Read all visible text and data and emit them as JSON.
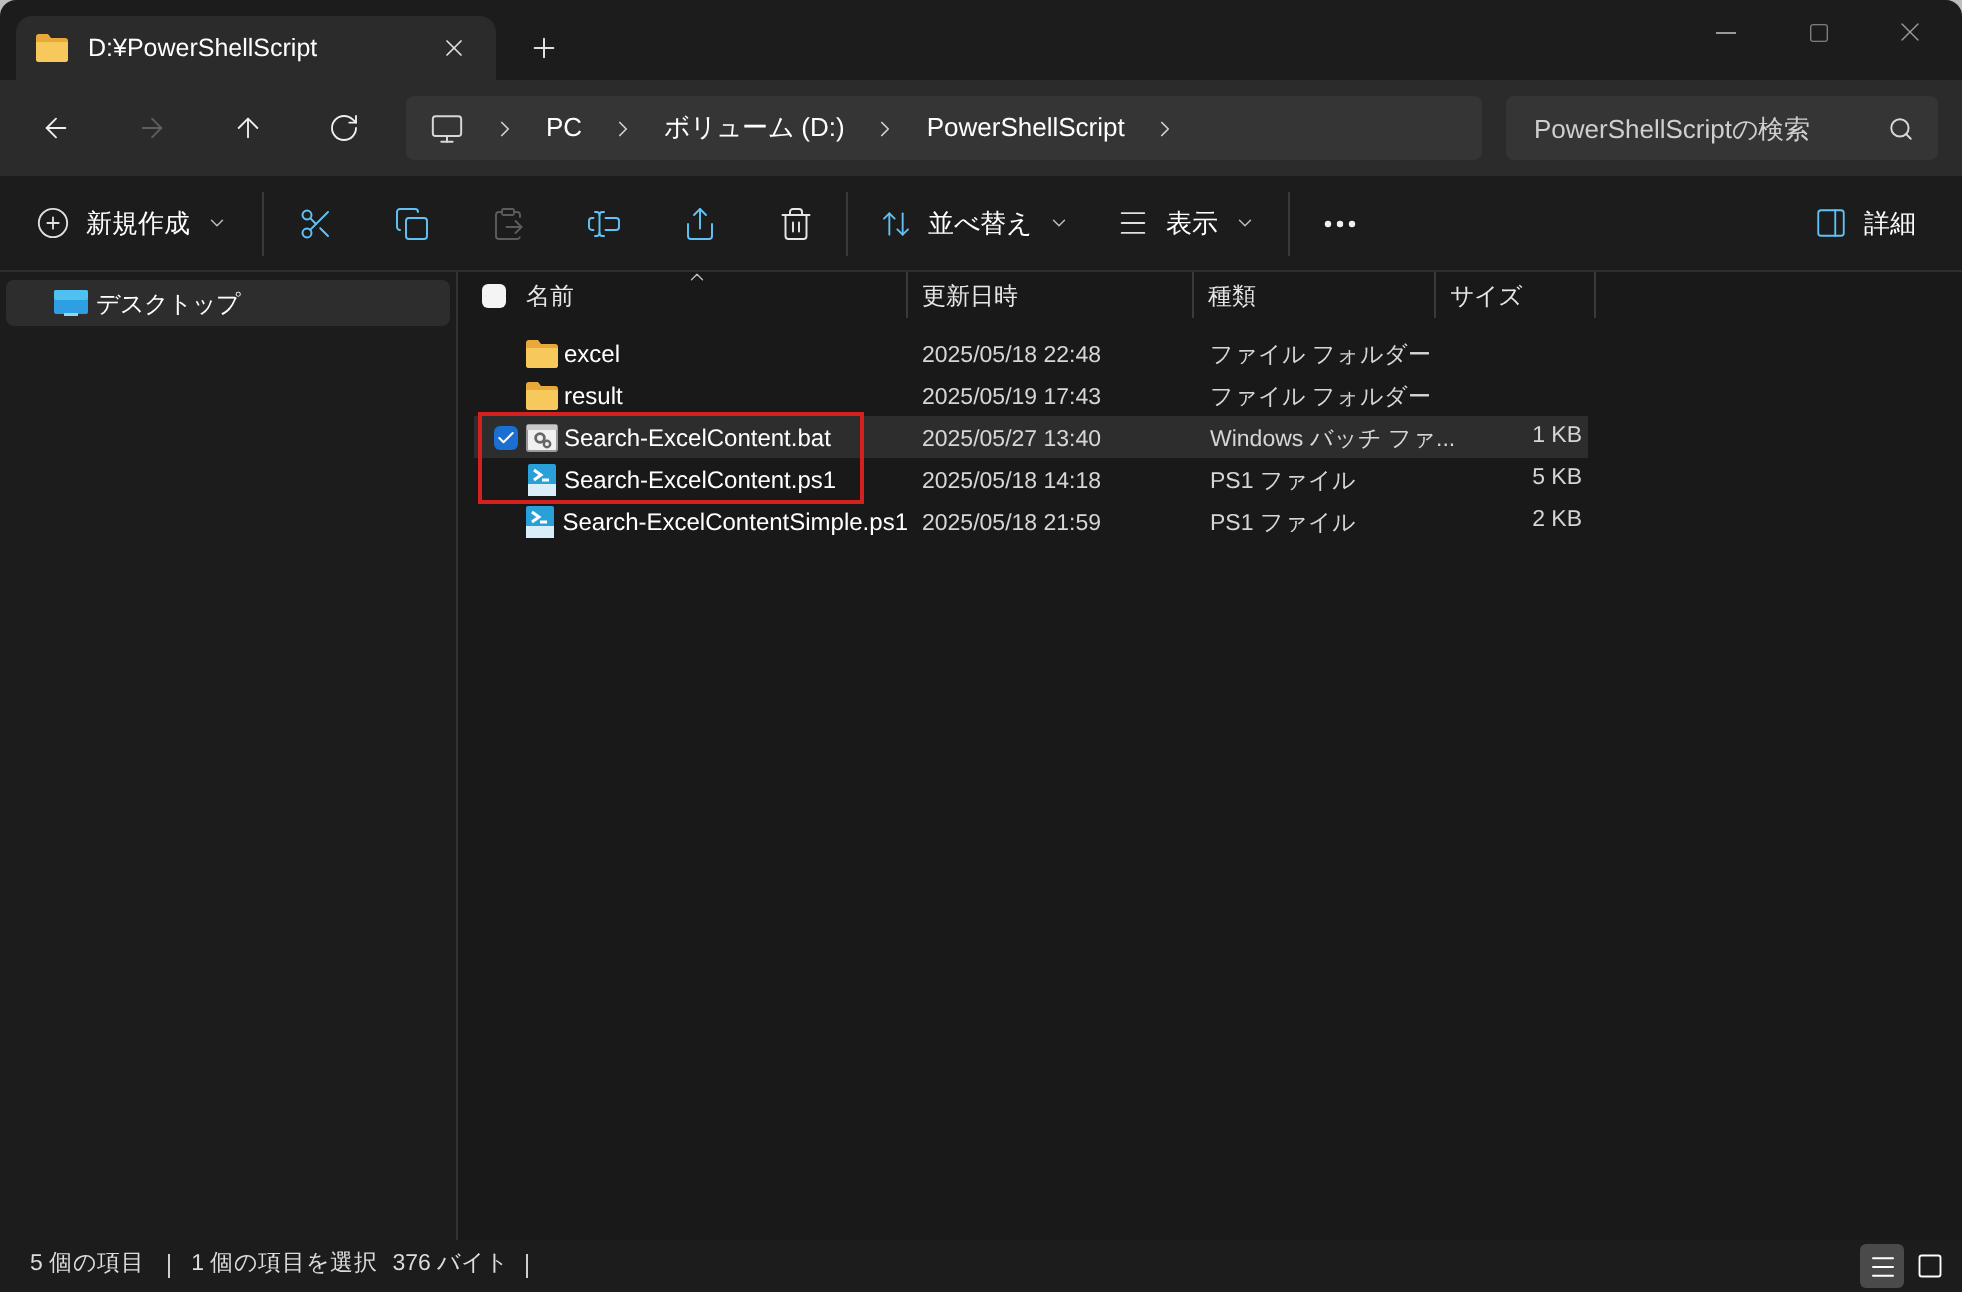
{
  "tab": {
    "title": "D:¥PowerShellScript"
  },
  "nav_buttons": [
    {
      "disabled": false
    },
    {
      "disabled": true
    },
    {
      "disabled": false
    },
    {
      "disabled": false
    }
  ],
  "breadcrumbs": [
    "PC",
    "ボリューム (D:)",
    "PowerShellScript"
  ],
  "search": {
    "placeholder": "PowerShellScriptの検索"
  },
  "toolbar": {
    "new": {
      "label": "新規作成"
    },
    "actions": [
      {
        "disabled": false
      },
      {
        "disabled": false
      },
      {
        "disabled": true
      },
      {
        "disabled": false
      },
      {
        "disabled": false
      },
      {
        "disabled": false
      }
    ],
    "sort": {
      "label": "並べ替え"
    },
    "view": {
      "label": "表示"
    },
    "details": {
      "label": "詳細"
    }
  },
  "sidebar": {
    "items": [
      {
        "label": "デスクトップ",
        "selected": true
      }
    ]
  },
  "table": {
    "select_all_checked": false,
    "columns": [
      {
        "label": "名前",
        "sorted": true
      },
      {
        "label": "更新日時",
        "sorted": false
      },
      {
        "label": "種類",
        "sorted": false
      },
      {
        "label": "サイズ",
        "sorted": false
      }
    ],
    "rows": [
      {
        "kind": "folder",
        "name": "excel",
        "modified": "2025/05/18 22:48",
        "type": "ファイル フォルダー",
        "size": "",
        "selected": false,
        "outlined": false
      },
      {
        "kind": "folder",
        "name": "result",
        "modified": "2025/05/19 17:43",
        "type": "ファイル フォルダー",
        "size": "",
        "selected": false,
        "outlined": false
      },
      {
        "kind": "bat",
        "name": "Search-ExcelContent.bat",
        "modified": "2025/05/27 13:40",
        "type": "Windows バッチ ファ...",
        "size": "1 KB",
        "selected": true,
        "outlined": true
      },
      {
        "kind": "ps1",
        "name": "Search-ExcelContent.ps1",
        "modified": "2025/05/18 14:18",
        "type": "PS1 ファイル",
        "size": "5 KB",
        "selected": false,
        "outlined": true
      },
      {
        "kind": "ps1",
        "name": "Search-ExcelContentSimple.ps1",
        "modified": "2025/05/18 21:59",
        "type": "PS1 ファイル",
        "size": "2 KB",
        "selected": false,
        "outlined": false
      }
    ]
  },
  "status_bar": {
    "item_count": "5 個の項目",
    "selection": "1 個の項目を選択",
    "selection_size": "376 バイト",
    "views": [
      {
        "selected": true
      },
      {
        "selected": false
      }
    ]
  }
}
